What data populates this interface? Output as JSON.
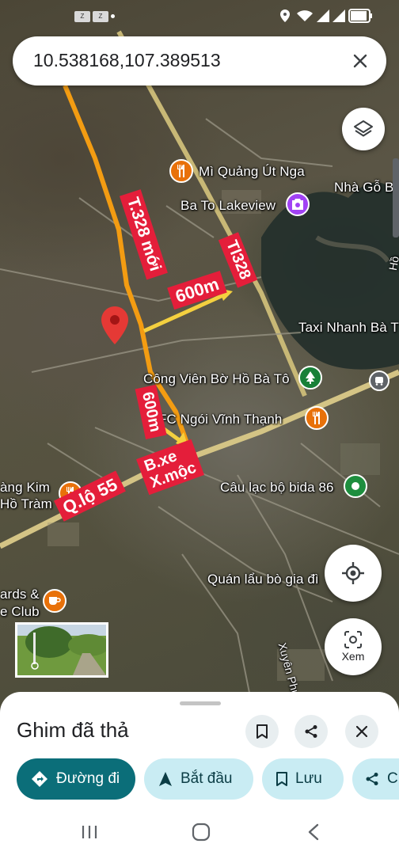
{
  "search": {
    "query": "10.538168,107.389513"
  },
  "map": {
    "places": [
      {
        "name": "Mì Quảng Út Nga",
        "kind": "food"
      },
      {
        "name": "Ba To Lakeview",
        "kind": "photo"
      },
      {
        "name": "Nhà Gỗ Be"
      },
      {
        "name": "Taxi Nhanh Bà T"
      },
      {
        "name": "Công Viên Bờ Hồ Bà Tô",
        "kind": "park"
      },
      {
        "name": "FC Ngói Vĩnh Thạnh",
        "kind": "food"
      },
      {
        "name": "Câu lạc bộ bida 86",
        "kind": "ball"
      },
      {
        "name": "àng Kim"
      },
      {
        "name": "Hồ Tràm"
      },
      {
        "name": "ards &"
      },
      {
        "name": "e Club"
      },
      {
        "name": "Quán lẩu bò gia đì"
      },
      {
        "name": "Xuyên Phước Cơ"
      },
      {
        "name": "Hồ"
      }
    ],
    "annotations": {
      "road_new": "T.328 mới",
      "road_tl": "Tl328",
      "dist1": "600m",
      "dist2": "600m",
      "station": "B.xe\nX.mộc",
      "highway": "Q.lộ 55"
    }
  },
  "controls": {
    "layers_icon": "layers-icon",
    "location_icon": "my-location-icon",
    "lens_label": "Xem"
  },
  "sheet": {
    "title": "Ghim đã thả",
    "directions_label": "Đường đi",
    "start_label": "Bắt đầu",
    "save_label": "Lưu",
    "share_label": "C"
  },
  "colors": {
    "accent": "#0b6e79",
    "accent_light": "#c9ecf3",
    "pin": "#e53935",
    "tag_red": "#e41e3a",
    "route_orange": "#f39c12",
    "arrow_yellow": "#f4d03f"
  }
}
